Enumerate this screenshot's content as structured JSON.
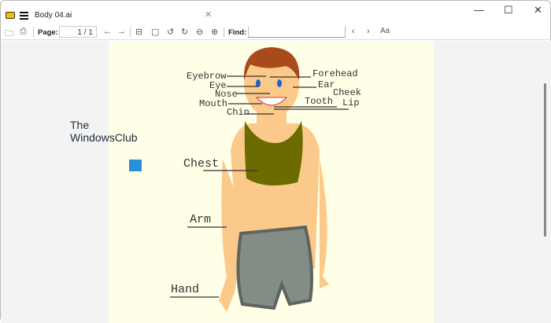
{
  "window": {
    "title": "Body 04.ai",
    "minimize": "—",
    "maximize": "☐",
    "close": "✕",
    "tab_close": "✕"
  },
  "toolbar": {
    "page_label": "Page:",
    "page_value": "1 / 1",
    "find_label": "Find:",
    "find_value": "",
    "match_case": "Aa",
    "prev": "‹",
    "next": "›",
    "back": "←",
    "forward": "→"
  },
  "watermark": {
    "line1": "The",
    "line2": "WindowsClub"
  },
  "labels": {
    "eyebrow": "Eyebrow",
    "eye": "Eye",
    "nose": "Nose",
    "mouth": "Mouth",
    "chin": "Chin",
    "forehead": "Forehead",
    "ear": "Ear",
    "cheek": "Cheek",
    "tooth": "Tooth",
    "lip": "Lip",
    "chest": "Chest",
    "arm": "Arm",
    "hand": "Hand"
  }
}
